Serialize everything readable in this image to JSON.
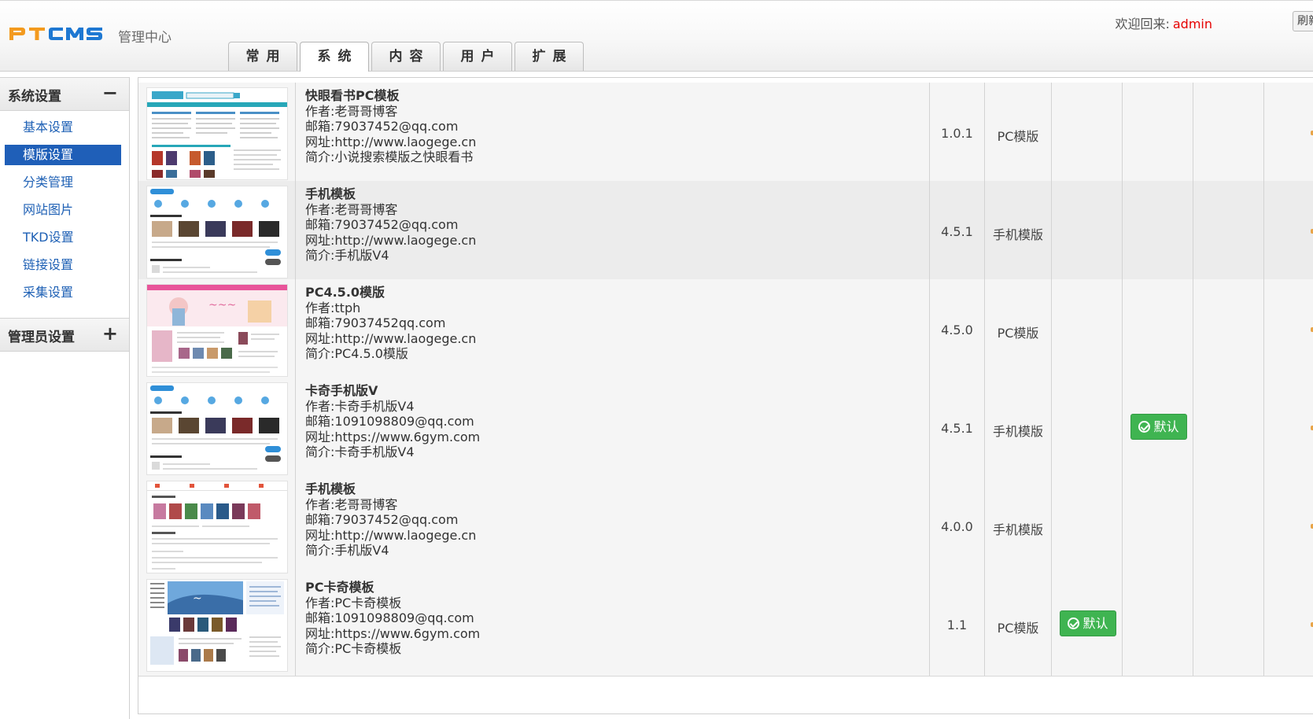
{
  "header": {
    "logo_text": "PTCMS",
    "logo_subtitle": "管理中心",
    "welcome_label": "欢迎回来:",
    "username": "admin",
    "refresh_label": "刷新"
  },
  "tabs": [
    {
      "label": "常用",
      "active": false
    },
    {
      "label": "系统",
      "active": true
    },
    {
      "label": "内容",
      "active": false
    },
    {
      "label": "用户",
      "active": false
    },
    {
      "label": "扩展",
      "active": false
    }
  ],
  "sidebar": {
    "groups": [
      {
        "label": "系统设置",
        "toggle": "−",
        "items": [
          {
            "label": "基本设置",
            "active": false
          },
          {
            "label": "模版设置",
            "active": true
          },
          {
            "label": "分类管理",
            "active": false
          },
          {
            "label": "网站图片",
            "active": false
          },
          {
            "label": "TKD设置",
            "active": false
          },
          {
            "label": "链接设置",
            "active": false
          },
          {
            "label": "采集设置",
            "active": false
          }
        ]
      },
      {
        "label": "管理员设置",
        "toggle": "+",
        "items": []
      }
    ]
  },
  "templates": [
    {
      "name": "快眼看书PC模板",
      "author": "作者:老哥哥博客",
      "email": "邮箱:79037452@qq.com",
      "url": "网址:http://www.laogege.cn",
      "intro": "简介:小说搜索模版之快眼看书",
      "version": "1.0.1",
      "type": "PC模版",
      "pc_default": false,
      "mobile_default": false
    },
    {
      "name": "手机模板",
      "author": "作者:老哥哥博客",
      "email": "邮箱:79037452@qq.com",
      "url": "网址:http://www.laogege.cn",
      "intro": "简介:手机版V4",
      "version": "4.5.1",
      "type": "手机模版",
      "pc_default": false,
      "mobile_default": false
    },
    {
      "name": "PC4.5.0模版",
      "author": "作者:ttph",
      "email": "邮箱:79037452qq.com",
      "url": "网址:http://www.laogege.cn",
      "intro": "简介:PC4.5.0模版",
      "version": "4.5.0",
      "type": "PC模版",
      "pc_default": false,
      "mobile_default": false
    },
    {
      "name": "卡奇手机版V",
      "author": "作者:卡奇手机版V4",
      "email": "邮箱:1091098809@qq.com",
      "url": "网址:https://www.6gym.com",
      "intro": "简介:卡奇手机版V4",
      "version": "4.5.1",
      "type": "手机模版",
      "pc_default": false,
      "mobile_default": true
    },
    {
      "name": "手机模板",
      "author": "作者:老哥哥博客",
      "email": "邮箱:79037452@qq.com",
      "url": "网址:http://www.laogege.cn",
      "intro": "简介:手机版V4",
      "version": "4.0.0",
      "type": "手机模版",
      "pc_default": false,
      "mobile_default": false
    },
    {
      "name": "PC卡奇模板",
      "author": "作者:PC卡奇模板",
      "email": "邮箱:1091098809@qq.com",
      "url": "网址:https://www.6gym.com",
      "intro": "简介:PC卡奇模板",
      "version": "1.1",
      "type": "PC模版",
      "pc_default": true,
      "mobile_default": false
    }
  ],
  "default_button_label": "默认",
  "colors": {
    "logo_orange": "#f39a1e",
    "logo_blue": "#1e78d2",
    "link_blue": "#1f61b5",
    "active_blue": "#1f5fb8",
    "default_green": "#3fb451",
    "welcome_red": "#e60000"
  }
}
